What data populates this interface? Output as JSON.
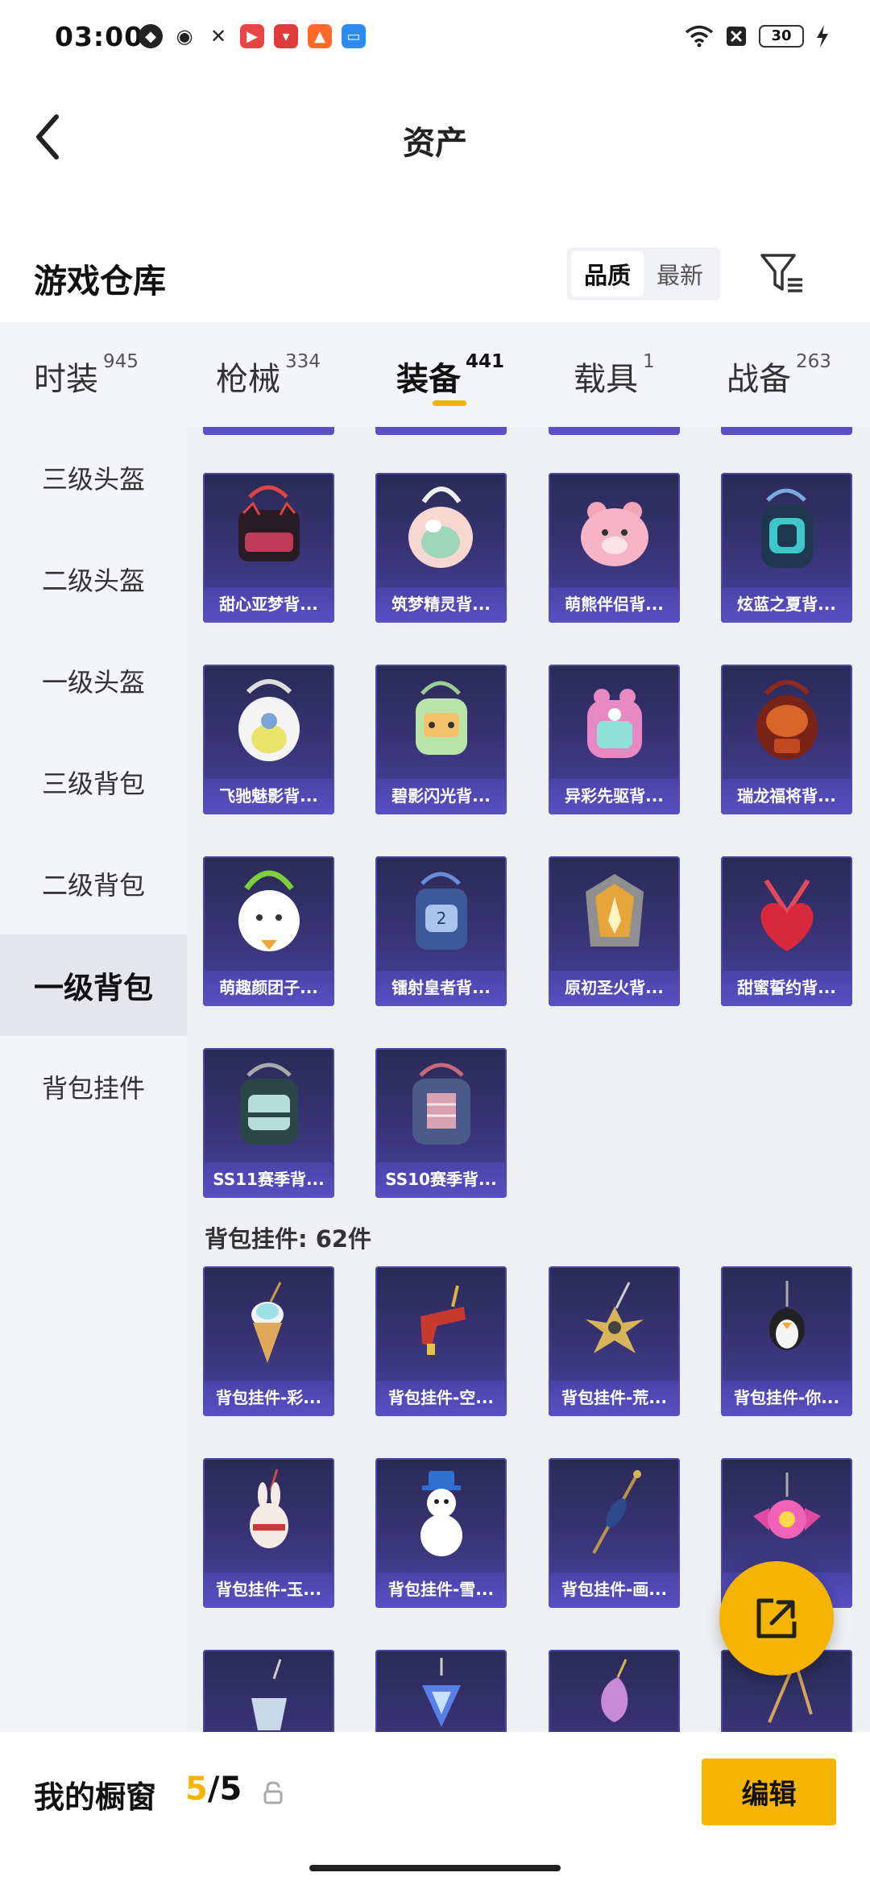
{
  "status_bar": {
    "time": "03:00",
    "battery": "30"
  },
  "header": {
    "title": "资产"
  },
  "section": {
    "title": "游戏仓库",
    "sort_options": [
      "品质",
      "最新"
    ],
    "active_sort": "品质"
  },
  "category_tabs": [
    {
      "label": "时装",
      "count": "945"
    },
    {
      "label": "枪械",
      "count": "334"
    },
    {
      "label": "装备",
      "count": "441"
    },
    {
      "label": "载具",
      "count": "1"
    },
    {
      "label": "战备",
      "count": "263"
    }
  ],
  "active_category": "装备",
  "sub_nav": [
    "三级头盔",
    "二级头盔",
    "一级头盔",
    "三级背包",
    "二级背包",
    "一级背包",
    "背包挂件"
  ],
  "active_sub": "一级背包",
  "backpacks": [
    "甜心亚梦背...",
    "筑梦精灵背...",
    "萌熊伴侣背...",
    "炫蓝之夏背...",
    "飞驰魅影背...",
    "碧影闪光背...",
    "异彩先驱背...",
    "瑞龙福将背...",
    "萌趣颜团子...",
    "镭射皇者背...",
    "原初圣火背...",
    "甜蜜誓约背...",
    "SS11赛季背...",
    "SS10赛季背..."
  ],
  "pendant_group": {
    "title": "背包挂件: 62件"
  },
  "pendants": [
    "背包挂件-彩...",
    "背包挂件-空...",
    "背包挂件-荒...",
    "背包挂件-你...",
    "背包挂件-玉...",
    "背包挂件-雪...",
    "背包挂件-画...",
    "",
    "",
    "",
    "",
    ""
  ],
  "bottom_bar": {
    "label": "我的橱窗",
    "count_current": "5",
    "count_max": "/5",
    "edit_label": "编辑"
  },
  "colors": {
    "accent": "#f5b400",
    "tile_bg": "#3a3478",
    "tile_label_bg": "#5a4fc4"
  }
}
